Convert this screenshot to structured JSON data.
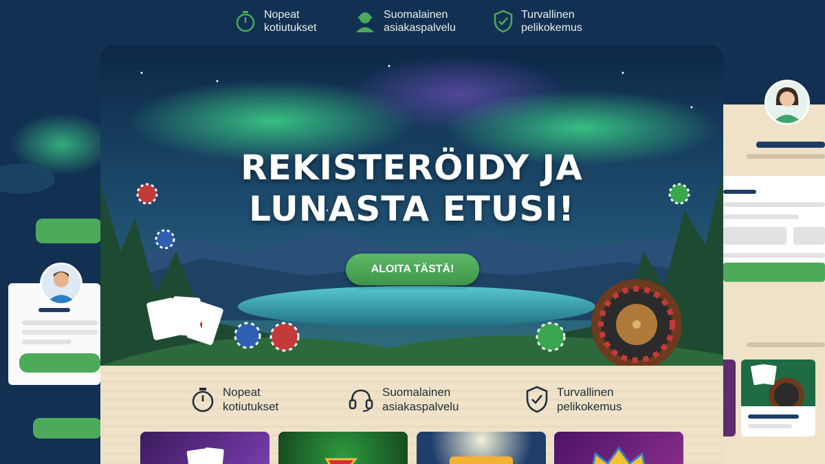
{
  "top_features": [
    {
      "icon": "stopwatch-icon",
      "line1": "Nopeat",
      "line2": "kotiutukset"
    },
    {
      "icon": "support-agent-icon",
      "line1": "Suomalainen",
      "line2": "asiakaspalvelu"
    },
    {
      "icon": "shield-check-icon",
      "line1": "Turvallinen",
      "line2": "pelikokemus"
    }
  ],
  "hero": {
    "title_line1": "REKISTERÖIDY JA",
    "title_line2": "LUNASTA ETUSI!",
    "cta_label": "ALOITA TÄSTÄ!"
  },
  "features": [
    {
      "icon": "stopwatch-icon",
      "line1": "Nopeat",
      "line2": "kotiutukset"
    },
    {
      "icon": "headset-icon",
      "line1": "Suomalainen",
      "line2": "asiakaspalvelu"
    },
    {
      "icon": "shield-check-icon",
      "line1": "Turvallinen",
      "line2": "pelikokemus"
    }
  ],
  "game_tiles": [
    {
      "name": "cards-game",
      "label": ""
    },
    {
      "name": "sevens-slot",
      "label": ""
    },
    {
      "name": "moon-slot",
      "label": ""
    },
    {
      "name": "crown-slot",
      "label": ""
    }
  ],
  "colors": {
    "background": "#123152",
    "accent_green": "#4caa5a",
    "title_text": "#ffffff",
    "dark_text": "#1f2e3a"
  }
}
